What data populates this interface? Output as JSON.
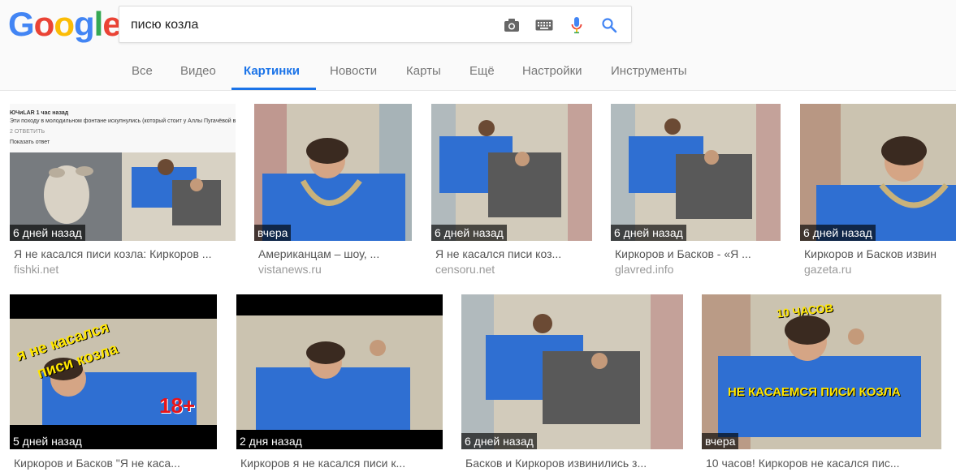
{
  "logo": {
    "letters": [
      "G",
      "o",
      "o",
      "g",
      "l",
      "e"
    ],
    "colors": [
      "#4285F4",
      "#EA4335",
      "#FBBC05",
      "#4285F4",
      "#34A853",
      "#EA4335"
    ]
  },
  "search": {
    "query": "писю козла"
  },
  "icons": {
    "camera": "camera-icon",
    "keyboard": "keyboard-icon",
    "mic": "microphone-icon",
    "search": "search-icon"
  },
  "tabs": [
    {
      "label": "Все"
    },
    {
      "label": "Видео"
    },
    {
      "label": "Картинки"
    },
    {
      "label": "Новости"
    },
    {
      "label": "Карты"
    },
    {
      "label": "Ещё"
    },
    {
      "label": "Настройки"
    },
    {
      "label": "Инструменты"
    }
  ],
  "accent": "#1a73e8",
  "results": [
    {
      "badge": "6 дней назад",
      "caption": "Я не касался писи козла: Киркоров ...",
      "source": "fishki.net",
      "thumb_text": {
        "line1": "ЮЧиLAR 1 час назад",
        "line2": "Эти походу в молодильном фонтане искупнулись (который стоит у Аллы Пугачёвой в доме)",
        "line3": "2  ОТВЕТИТЬ",
        "line4": "Показать ответ"
      }
    },
    {
      "badge": "вчера",
      "caption": "Американцам – шоу, ...",
      "source": "vistanews.ru"
    },
    {
      "badge": "6 дней назад",
      "caption": "Я не касался писи коз...",
      "source": "censoru.net"
    },
    {
      "badge": "6 дней назад",
      "caption": "Киркоров и Басков - «Я ...",
      "source": "glavred.info"
    },
    {
      "badge": "6 дней назад",
      "caption": "Киркоров и Басков извин",
      "source": "gazeta.ru"
    },
    {
      "badge": "5 дней назад",
      "caption": "Киркоров и Басков \"Я не каса...",
      "source": "",
      "thumb_text": {
        "line1": "я не касался",
        "line2": "писи козла",
        "line3": "18+"
      }
    },
    {
      "badge": "2 дня назад",
      "caption": "Киркоров я не касался писи к...",
      "source": ""
    },
    {
      "badge": "6 дней назад",
      "caption": "Басков и Киркоров извинились з...",
      "source": ""
    },
    {
      "badge": "вчера",
      "caption": "10 часов! Киркоров не касался пис...",
      "source": "",
      "thumb_text": {
        "line1": "10 ЧАСОВ",
        "line2": "НЕ КАСАЕМСЯ ПИСИ КОЗЛА"
      }
    }
  ]
}
